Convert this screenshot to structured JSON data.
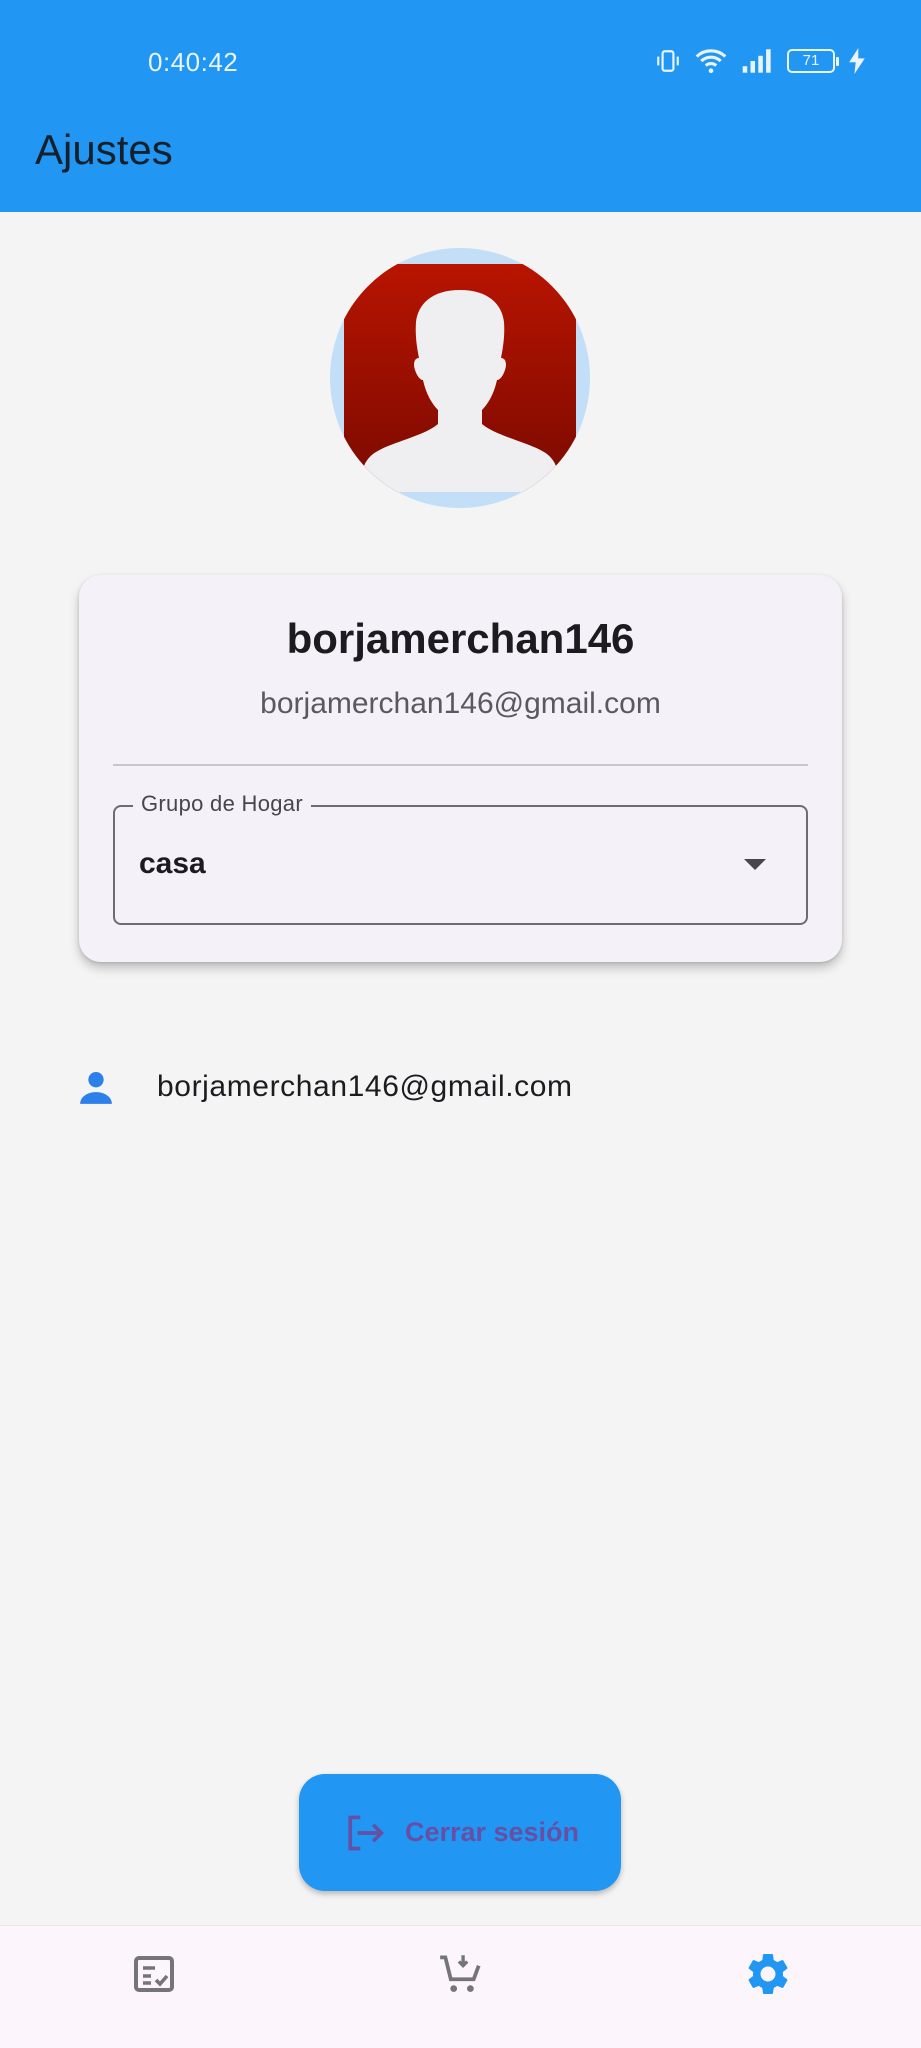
{
  "status_bar": {
    "time": "0:40:42",
    "battery_level": "71"
  },
  "app_bar": {
    "title": "Ajustes"
  },
  "profile": {
    "username": "borjamerchan146",
    "email": "borjamerchan146@gmail.com"
  },
  "household_group": {
    "label": "Grupo de Hogar",
    "selected": "casa"
  },
  "account_tile": {
    "icon": "person-icon",
    "text": "borjamerchan146@gmail.com"
  },
  "logout": {
    "label": "Cerrar sesión",
    "icon": "logout-icon"
  },
  "bottom_nav": {
    "items": [
      {
        "icon": "checklist-icon",
        "active": false
      },
      {
        "icon": "cart-icon",
        "active": false
      },
      {
        "icon": "settings-icon",
        "active": true
      }
    ]
  },
  "colors": {
    "primary": "#2196f3",
    "nav_inactive": "#747479",
    "logout_text": "#6650a4",
    "avatar_red": "#b81400"
  }
}
